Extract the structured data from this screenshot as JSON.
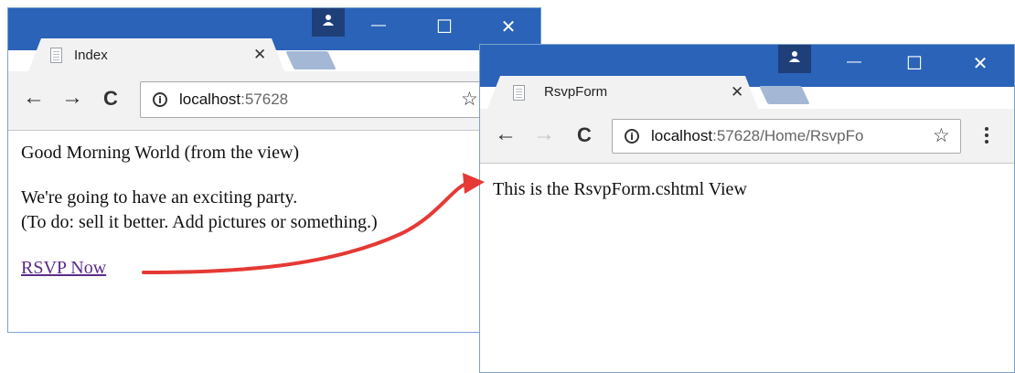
{
  "index_window": {
    "tab_title": "Index",
    "tab_close": "✕",
    "url_host": "localhost",
    "url_port": ":57628",
    "greeting": "Good Morning World (from the view)",
    "party_line": "We're going to have an exciting party.",
    "todo_line": "(To do: sell it better. Add pictures or something.)",
    "rsvp_link": "RSVP Now"
  },
  "rsvp_window": {
    "tab_title": "RsvpForm",
    "tab_close": "✕",
    "url_host": "localhost",
    "url_path": ":57628/Home/RsvpFo",
    "body_text": "This is the RsvpForm.cshtml View"
  },
  "window_controls": {
    "minimize": "—",
    "maximize": "☐",
    "close": "✕"
  },
  "nav_glyphs": {
    "back": "←",
    "forward": "→",
    "reload": "C",
    "bookmark": "☆",
    "info": "i"
  },
  "colors": {
    "titlebar": "#2a63b8",
    "arrow": "#e53935",
    "link": "#5b2c8a"
  }
}
